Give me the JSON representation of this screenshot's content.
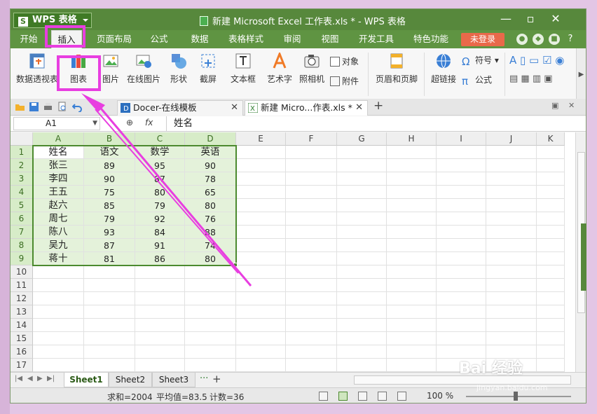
{
  "app": {
    "wps_button": "WPS 表格",
    "doc_title": "新建 Microsoft Excel 工作表.xls * - WPS 表格",
    "min": "—",
    "max": "▫",
    "close": "✕"
  },
  "menu": {
    "items": [
      "开始",
      "插入",
      "页面布局",
      "公式",
      "数据",
      "表格样式",
      "审阅",
      "视图",
      "开发工具",
      "特色功能"
    ],
    "login": "未登录",
    "help": "?"
  },
  "ribbon": {
    "pivot": "数据透视表",
    "chart": "图表",
    "picture": "图片",
    "online_picture": "在线图片",
    "shapes": "形状",
    "screenshot": "截屏",
    "textbox": "文本框",
    "wordart": "艺术字",
    "camera": "照相机",
    "object": "对象",
    "attachment": "附件",
    "header_footer": "页眉和页脚",
    "hyperlink": "超链接",
    "symbol": "符号",
    "formula": "公式"
  },
  "tabs": {
    "docer": "Docer-在线模板",
    "file": "新建 Micro...作表.xls *",
    "add": "+"
  },
  "formula_bar": {
    "name_box": "A1",
    "fx": "fx",
    "value": "姓名"
  },
  "grid": {
    "columns": [
      "A",
      "B",
      "C",
      "D",
      "E",
      "F",
      "G",
      "H",
      "I",
      "J",
      "K"
    ],
    "rows": [
      "1",
      "2",
      "3",
      "4",
      "5",
      "6",
      "7",
      "8",
      "9",
      "10",
      "11",
      "12",
      "13",
      "14",
      "15",
      "16",
      "17"
    ],
    "data": [
      [
        "姓名",
        "语文",
        "数学",
        "英语"
      ],
      [
        "张三",
        "89",
        "95",
        "90"
      ],
      [
        "李四",
        "90",
        "87",
        "78"
      ],
      [
        "王五",
        "75",
        "80",
        "65"
      ],
      [
        "赵六",
        "85",
        "79",
        "80"
      ],
      [
        "周七",
        "79",
        "92",
        "76"
      ],
      [
        "陈八",
        "93",
        "84",
        "88"
      ],
      [
        "吴九",
        "87",
        "91",
        "74"
      ],
      [
        "蒋十",
        "81",
        "86",
        "80"
      ]
    ]
  },
  "sheets": [
    "Sheet1",
    "Sheet2",
    "Sheet3"
  ],
  "sheets_more": "···",
  "sheets_add": "+",
  "status": {
    "sum": "求和=2004",
    "avg": "平均值=83.5",
    "count": "计数=36",
    "zoom": "100 %"
  },
  "colors": {
    "title_green": "#57883c",
    "selection_green": "#4c8a2f",
    "highlight_magenta": "#e83ee0",
    "login_orange": "#e9694a"
  }
}
